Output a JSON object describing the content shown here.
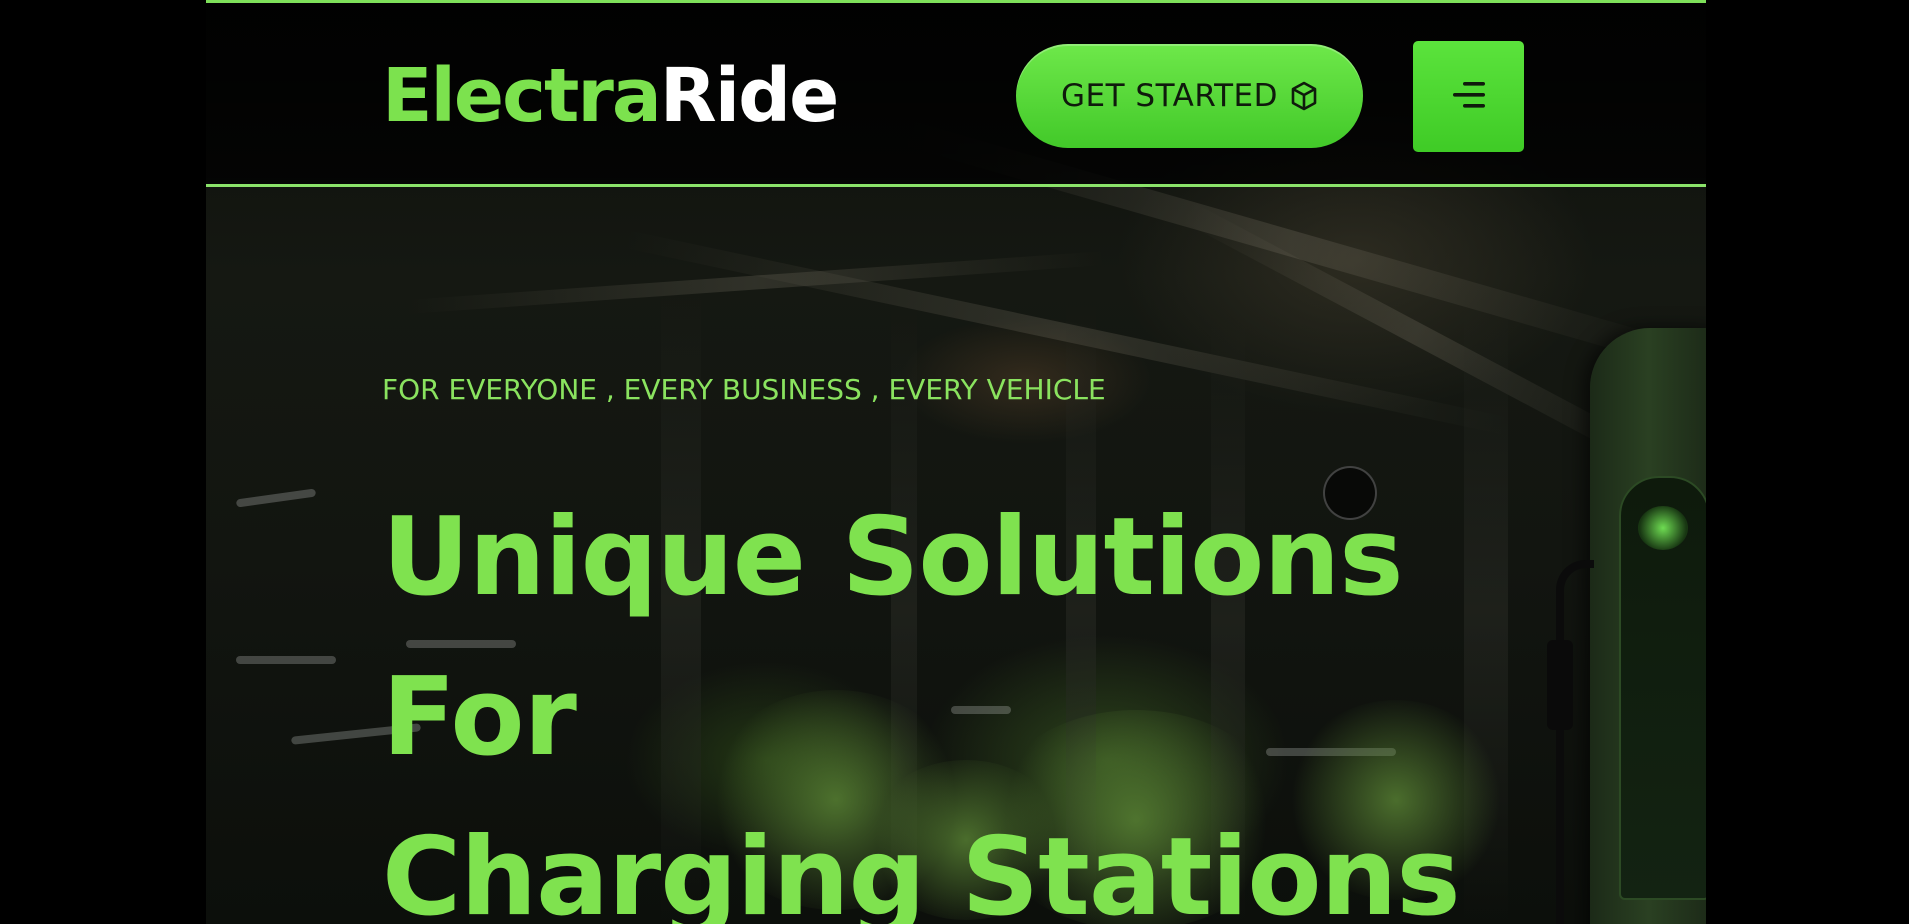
{
  "brand": {
    "name_part1": "Electra",
    "name_part2": "Ride"
  },
  "header": {
    "cta_label": "GET STARTED",
    "cta_icon": "cube-icon",
    "menu_icon": "hamburger-menu-icon"
  },
  "hero": {
    "tagline": "FOR EVERYONE , EVERY BUSINESS , EVERY VEHICLE",
    "headline_lines": [
      "Unique Solutions",
      "For",
      "Charging Stations"
    ]
  },
  "colors": {
    "accent": "#7ce24e",
    "button": "#4fd232",
    "background": "#000000",
    "divider": "#8be36a"
  }
}
